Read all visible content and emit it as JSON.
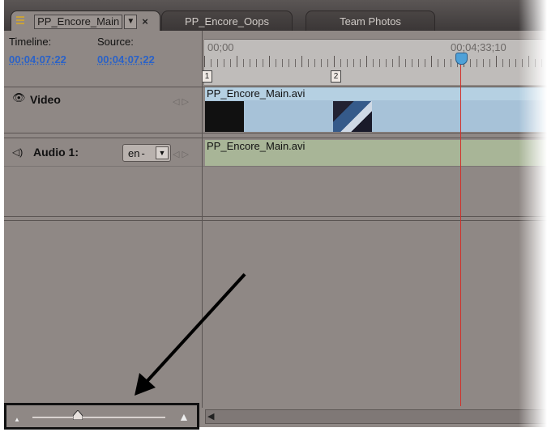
{
  "tabs": [
    {
      "label": "PP_Encore_Main",
      "active": true
    },
    {
      "label": "PP_Encore_Oops",
      "active": false
    },
    {
      "label": "Team Photos",
      "active": false
    }
  ],
  "close_glyph": "×",
  "menu_glyph": "▼",
  "header": {
    "timeline_label": "Timeline:",
    "timeline_value": "00;04;07;22",
    "source_label": "Source:",
    "source_value": "00;04;07;22"
  },
  "ruler": {
    "start_time": "00;00",
    "current_time": "00;04;33;10",
    "marker_1": "1",
    "marker_2": "2"
  },
  "tracks": {
    "video": {
      "name": "Video",
      "clip": "PP_Encore_Main.avi"
    },
    "audio": {
      "name": "Audio 1:",
      "clip": "PP_Encore_Main.avi",
      "language": "en"
    }
  },
  "colors": {
    "panel": "#8f8885",
    "timecode": "#2a62c8",
    "playhead": "#d1302a",
    "video_clip": "#a7c2d8",
    "audio_clip": "#a8b597"
  },
  "icons": [
    "eye-icon",
    "speaker-icon",
    "keyframe-nav-icon",
    "zoom-small-icon",
    "zoom-large-icon",
    "scroll-left-icon"
  ]
}
